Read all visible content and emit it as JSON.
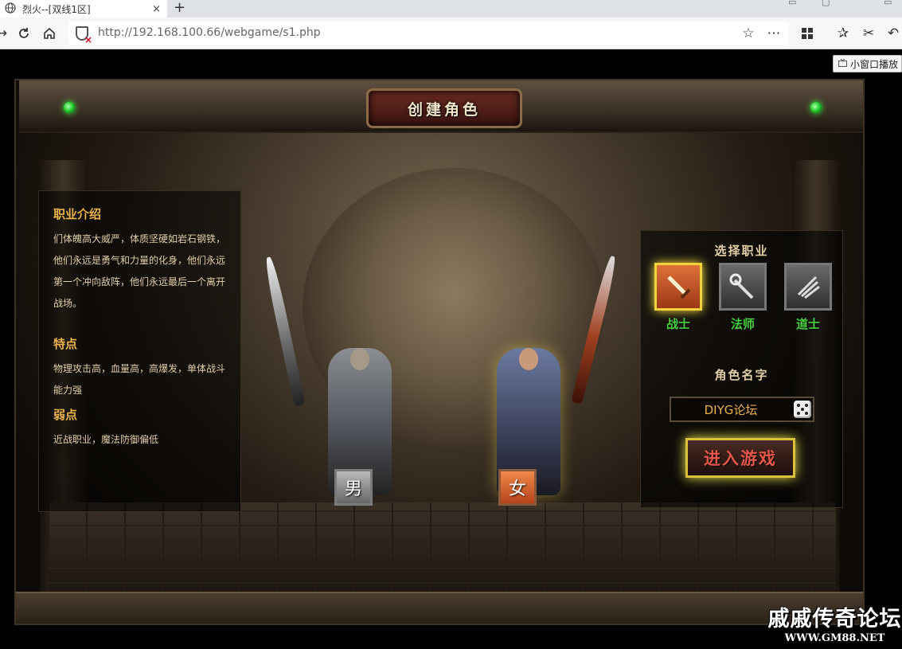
{
  "browser": {
    "tab_title": "烈火--[双线1区]",
    "tab_close": "×",
    "new_tab": "+",
    "url": "http://192.168.100.66/webgame/s1.php"
  },
  "page": {
    "mini_player_label": "小窗口播放",
    "title": "创建角色",
    "info": {
      "intro_heading": "职业介绍",
      "intro_text": "们体魄高大威严，体质坚硬如岩石钢铁，他们永远是勇气和力量的化身，他们永远第一个冲向敌阵，他们永远最后一个离开战场。",
      "traits_heading": "特点",
      "traits_text": "物理攻击高，血量高，高爆发，单体战斗能力强",
      "weakness_heading": "弱点",
      "weakness_text": "近战职业，魔法防御偏低"
    },
    "gender": {
      "male": "男",
      "female": "女"
    },
    "select_job_heading": "选择职业",
    "jobs": [
      {
        "label": "战士",
        "icon": "sword-icon",
        "selected": true
      },
      {
        "label": "法师",
        "icon": "staff-icon",
        "selected": false
      },
      {
        "label": "道士",
        "icon": "claw-icon",
        "selected": false
      }
    ],
    "name_heading": "角色名字",
    "name_value": "DIYG论坛",
    "enter_button": "进入游戏"
  },
  "watermark": {
    "title": "戚戚传奇论坛",
    "url": "WWW.GM88.NET"
  }
}
